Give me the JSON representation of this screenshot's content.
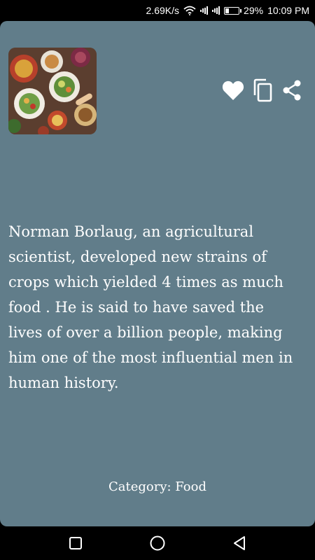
{
  "status_bar": {
    "network_speed": "2.69K/s",
    "battery_percent": "29%",
    "battery_level": 0.29,
    "time": "10:09 PM",
    "icons": [
      "wifi-icon",
      "signal-icon",
      "signal-icon",
      "battery-icon"
    ]
  },
  "fact": {
    "image_icon": "food-platter-image",
    "text": "Norman Borlaug, an agricultural scientist, developed new strains of crops which yielded 4 times as much food . He is said to have saved the lives of over a billion people, making him one of the most influential men in human history.",
    "category": "Category: Food"
  },
  "actions": [
    "favorite-icon",
    "copy-icon",
    "share-icon"
  ],
  "nav_bar": [
    "recents-button",
    "home-button",
    "back-button"
  ],
  "colors": {
    "card_background": "#617d8a",
    "text": "#ffffff",
    "bars": "#000000"
  }
}
